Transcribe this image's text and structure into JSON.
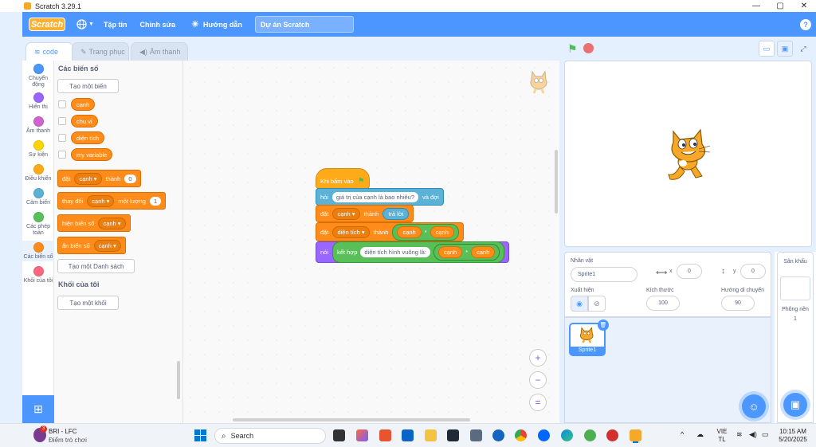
{
  "window": {
    "title": "Scratch 3.29.1",
    "minimize": "—",
    "maximize": "▢",
    "close": "✕"
  },
  "menubar": {
    "logo": "Scratch",
    "file": "Tập tin",
    "edit": "Chỉnh sửa",
    "tutorials": "Hướng dẫn",
    "project_title": "Dự án Scratch",
    "help": "?"
  },
  "tabs": {
    "code": "code",
    "costumes": "Trang phục",
    "sounds": "Âm thanh"
  },
  "categories": [
    {
      "label": "Chuyển động",
      "color": "#4c97ff"
    },
    {
      "label": "Hiển thị",
      "color": "#9966ff"
    },
    {
      "label": "Âm thanh",
      "color": "#cf63cf"
    },
    {
      "label": "Sự kiện",
      "color": "#ffd500"
    },
    {
      "label": "Điều khiển",
      "color": "#ffab19"
    },
    {
      "label": "Cảm biến",
      "color": "#5cb1d6"
    },
    {
      "label": "Các phép toán",
      "color": "#59c059"
    },
    {
      "label": "Các biến số",
      "color": "#ff8c1a"
    },
    {
      "label": "Khối của tôi",
      "color": "#ff6680"
    }
  ],
  "palette": {
    "variables_header": "Các biến số",
    "make_variable": "Tạo một biến",
    "variables": [
      "cạnh",
      "chu vi",
      "diện tích",
      "my variable"
    ],
    "set_block": {
      "label1": "đặt",
      "var": "cạnh",
      "label2": "thành",
      "value": "0"
    },
    "change_block": {
      "label1": "thay đổi",
      "var": "cạnh",
      "label2": "một lượng",
      "value": "1"
    },
    "show_block": {
      "label1": "hiện biến số",
      "var": "cạnh"
    },
    "hide_block": {
      "label1": "ẩn biến số",
      "var": "cạnh"
    },
    "make_list": "Tạo một Danh sách",
    "myblocks_header": "Khối của tôi",
    "make_block": "Tạo một khối"
  },
  "script": {
    "hat": "Khi bấm vào",
    "ask": {
      "label": "hỏi",
      "question": "giá trị của cạnh là bao nhiêu?",
      "suffix": "và đợi"
    },
    "set1": {
      "label": "đặt",
      "var": "cạnh",
      "to": "thành",
      "value": "trả lời"
    },
    "set2": {
      "label": "đặt",
      "var": "diện tích",
      "to": "thành",
      "left": "cạnh",
      "op": "*",
      "right": "cạnh"
    },
    "say": {
      "label": "nói",
      "join": "kết hợp",
      "text": "diện tích hình vuông là:",
      "left": "cạnh",
      "op": "*",
      "right": "cạnh"
    }
  },
  "zoom": {
    "in": "+",
    "out": "−",
    "reset": "="
  },
  "sprite_info": {
    "sprite_label": "Nhân vật",
    "sprite_name": "Sprite1",
    "x_label": "x",
    "x": "0",
    "y_label": "y",
    "y": "0",
    "show_label": "Xuất hiện",
    "size_label": "Kích thước",
    "size": "100",
    "direction_label": "Hướng di chuyển",
    "direction": "90"
  },
  "sprites": [
    {
      "name": "Sprite1"
    }
  ],
  "backdrop": {
    "stage_label": "Sân khấu",
    "backdrops_label": "Phông nền",
    "count": "1"
  },
  "taskbar": {
    "weather_title": "BRI - LFC",
    "weather_sub": "Điểm trò chơi",
    "weather_badge": "3",
    "search": "Search",
    "lang1": "VIE",
    "lang2": "TL",
    "time": "10:15 AM",
    "date": "5/20/2025"
  }
}
